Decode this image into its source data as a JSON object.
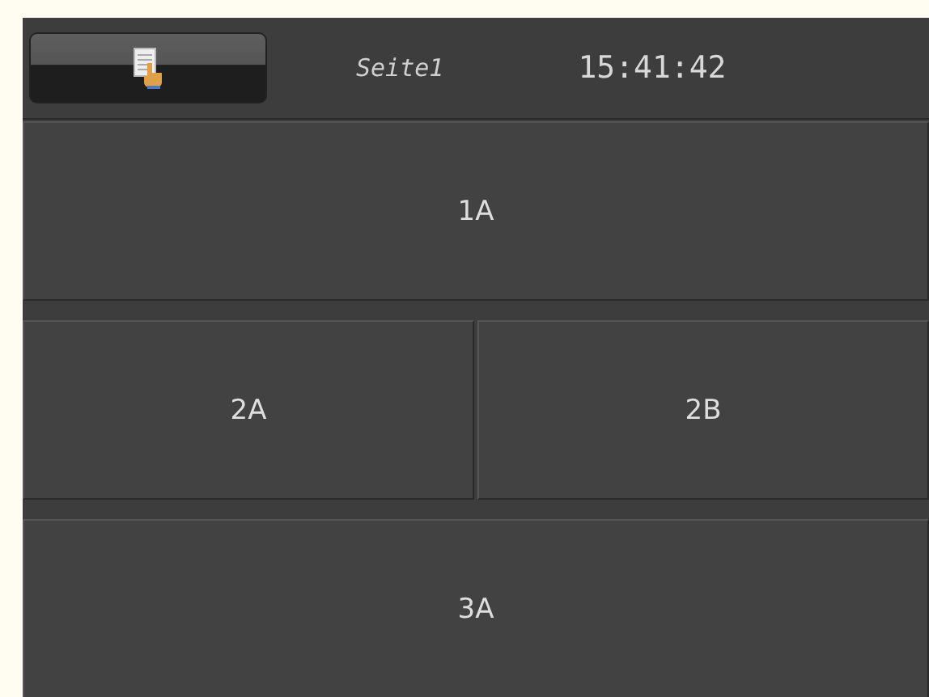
{
  "header": {
    "page_title": "Seite1",
    "time": "15:41:42"
  },
  "rows": [
    {
      "buttons": [
        "1A"
      ]
    },
    {
      "buttons": [
        "2A",
        "2B"
      ]
    },
    {
      "buttons": [
        "3A"
      ]
    }
  ]
}
